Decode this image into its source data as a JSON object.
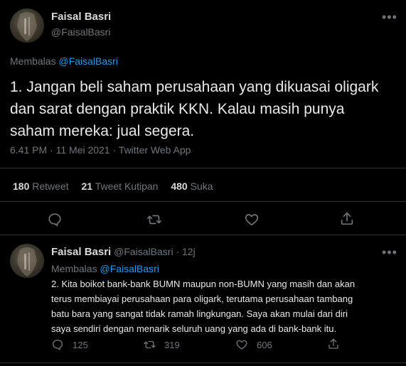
{
  "main_tweet": {
    "author_name": "Faisal Basri",
    "author_handle": "@FaisalBasri",
    "reply_prefix": "Membalas",
    "reply_to": "@FaisalBasri",
    "text_lines": [
      "1. Jangan beli saham perusahaan yang dikuasai oligark",
      "dan sarat dengan praktik KKN. Kalau masih punya",
      "saham mereka: jual segera."
    ],
    "meta": "6.41 PM · 11 Mei 2021 · Twitter Web App",
    "stats": {
      "retweets_count": "180",
      "retweets_label": "Retweet",
      "quotes_count": "21",
      "quotes_label": "Tweet Kutipan",
      "likes_count": "480",
      "likes_label": "Suka"
    },
    "more_icon": "more-dots-icon"
  },
  "reply_tweet": {
    "author_name": "Faisal Basri",
    "author_handle": "@FaisalBasri",
    "sep": "·",
    "time": "12j",
    "reply_prefix": "Membalas",
    "reply_to": "@FaisalBasri",
    "text_lines": [
      "2. Kita boikot bank-bank BUMN maupun non-BUMN yang masih dan akan",
      "terus membiayai perusahaan para oligark, terutama perusahaan tambang",
      "batu bara yang sangat tidak ramah lingkungan. Saya akan mulai dari diri",
      "saya sendiri dengan menarik seluruh uang yang ada di bank-bank itu."
    ],
    "actions": {
      "reply_count": "125",
      "retweet_count": "319",
      "like_count": "606"
    }
  },
  "colors": {
    "background": "#000000",
    "accent": "#1d9bf0",
    "muted": "#6e767d",
    "divider": "#2f3336"
  }
}
